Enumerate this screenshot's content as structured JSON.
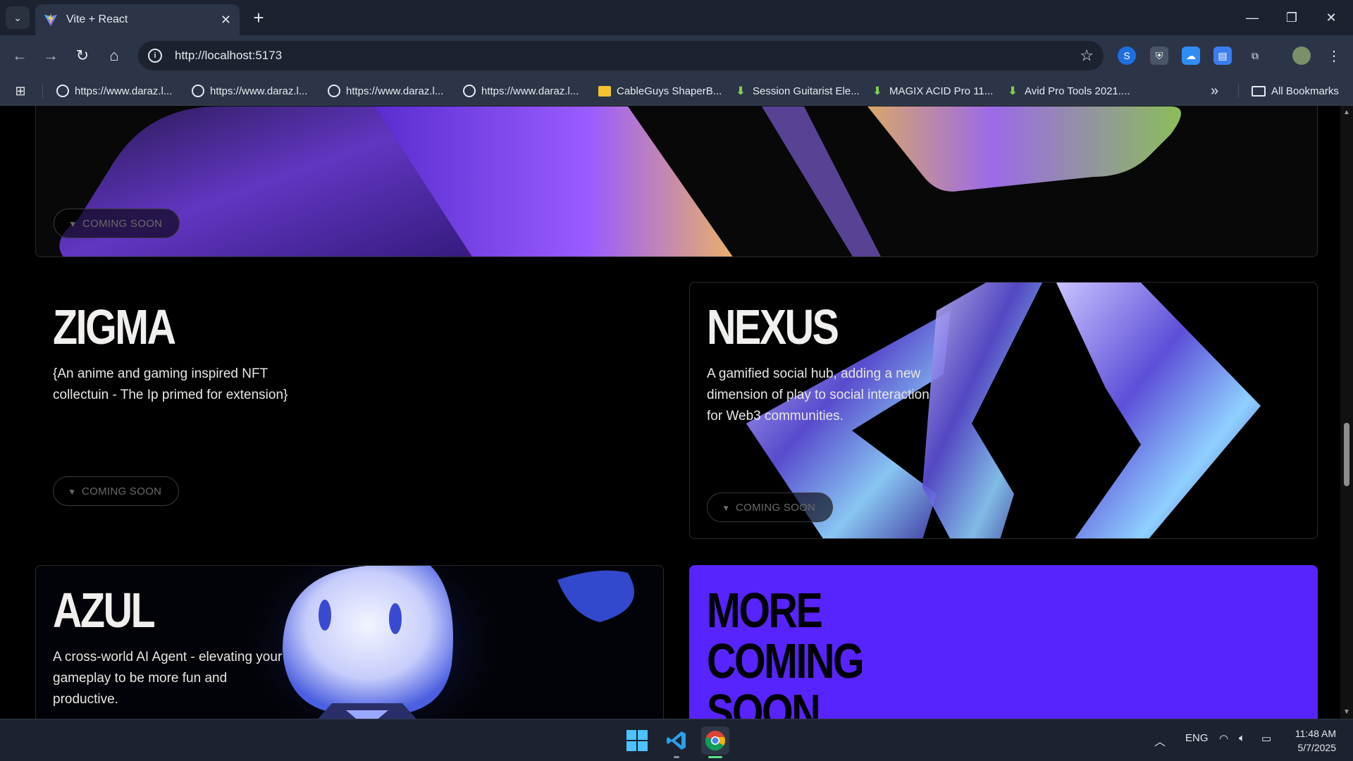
{
  "browser": {
    "tab_title": "Vite + React",
    "url": "http://localhost:5173",
    "bookmarks": [
      {
        "label": "https://www.daraz.l...",
        "icon": "globe-icon"
      },
      {
        "label": "https://www.daraz.l...",
        "icon": "globe-icon"
      },
      {
        "label": "https://www.daraz.l...",
        "icon": "globe-icon"
      },
      {
        "label": "https://www.daraz.l...",
        "icon": "globe-icon"
      },
      {
        "label": "CableGuys ShaperB...",
        "icon": "folder-icon"
      },
      {
        "label": "Session Guitarist Ele...",
        "icon": "download-icon"
      },
      {
        "label": "MAGIX ACID Pro 11...",
        "icon": "download-icon"
      },
      {
        "label": "Avid Pro Tools 2021....",
        "icon": "download-icon"
      }
    ],
    "all_bookmarks": "All Bookmarks",
    "overflow": "»"
  },
  "page": {
    "top_card": {
      "button": "COMING SOON"
    },
    "zigma": {
      "title": "ZIGMA",
      "description": "{An anime and gaming inspired NFT collectuin - The Ip primed for extension}",
      "button": "COMING SOON"
    },
    "nexus": {
      "title": "NEXUS",
      "description": "A gamified social hub, adding a new dimension of play to social interaction for Web3 communities.",
      "button": "COMING SOON"
    },
    "azul": {
      "title": "AZUL",
      "description": "A cross-world AI Agent - elevating your gameplay to be more fun and productive."
    },
    "more": {
      "title_lines": [
        "MORE",
        "COMING",
        "SOON"
      ],
      "color": "#5724ff"
    }
  },
  "taskbar": {
    "language": "ENG",
    "time": "11:48 AM",
    "date": "5/7/2025"
  }
}
